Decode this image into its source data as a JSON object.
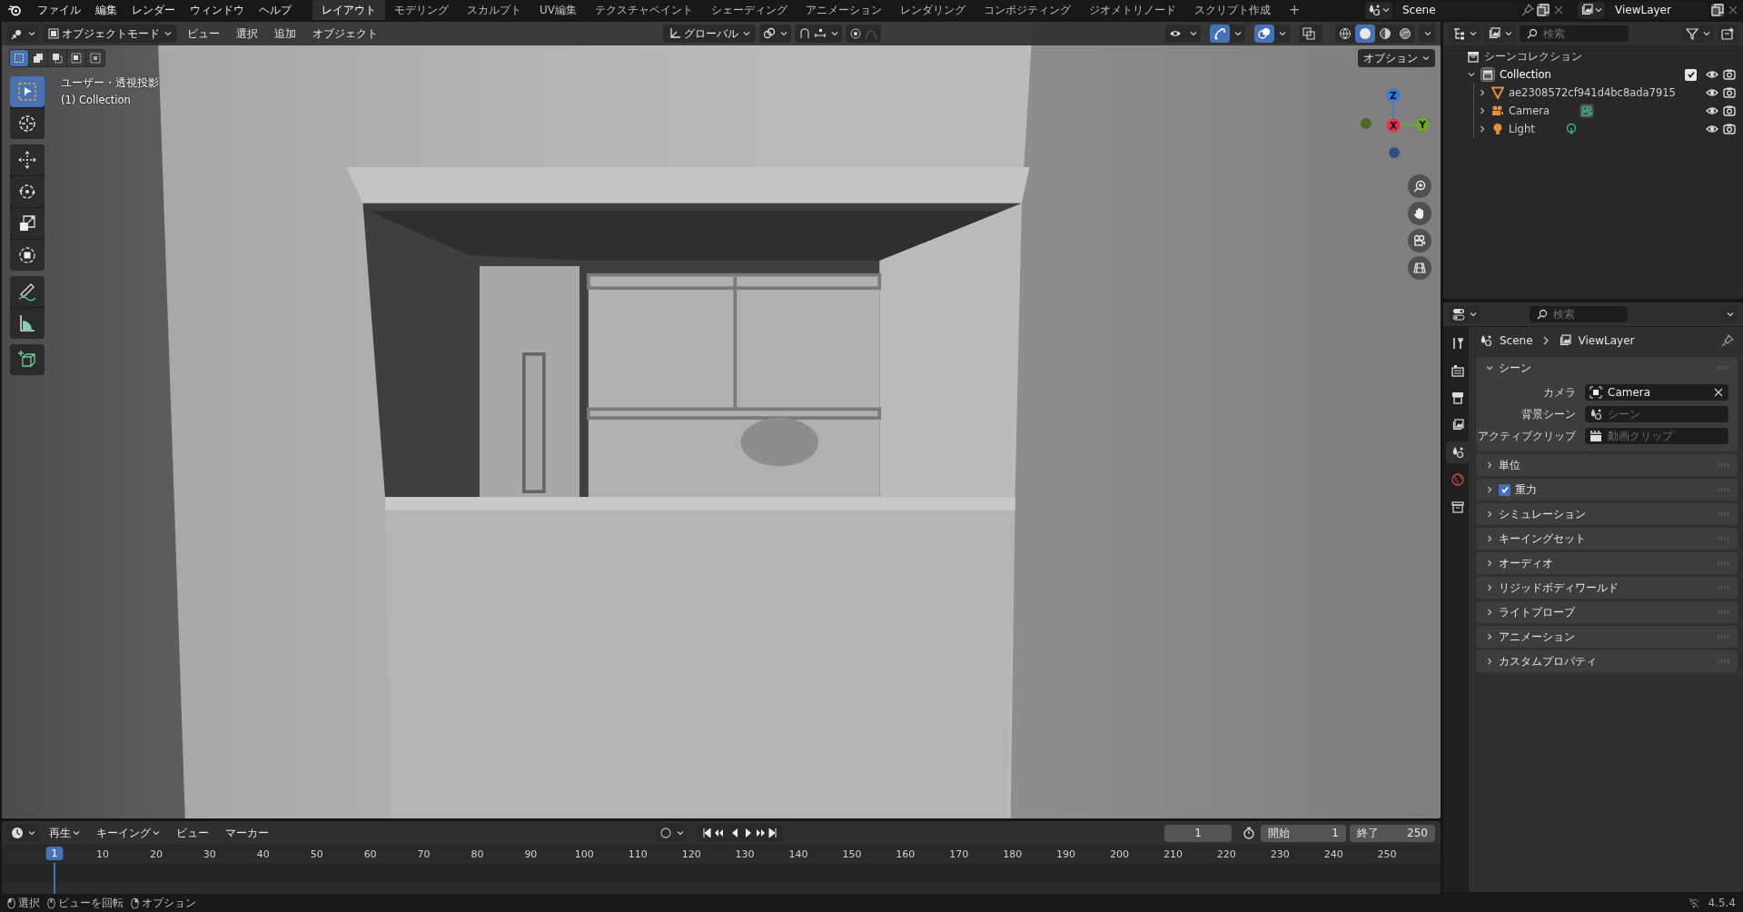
{
  "menu": [
    "ファイル",
    "編集",
    "レンダー",
    "ウィンドウ",
    "ヘルプ"
  ],
  "workspaces": [
    {
      "label": "レイアウト",
      "selected": true
    },
    {
      "label": "モデリング",
      "selected": false
    },
    {
      "label": "スカルプト",
      "selected": false
    },
    {
      "label": "UV編集",
      "selected": false
    },
    {
      "label": "テクスチャペイント",
      "selected": false
    },
    {
      "label": "シェーディング",
      "selected": false
    },
    {
      "label": "アニメーション",
      "selected": false
    },
    {
      "label": "レンダリング",
      "selected": false
    },
    {
      "label": "コンポジティング",
      "selected": false
    },
    {
      "label": "ジオメトリノード",
      "selected": false
    },
    {
      "label": "スクリプト作成",
      "selected": false
    }
  ],
  "add_workspace": "+",
  "scene": "Scene",
  "view_layer": "ViewLayer",
  "viewport": {
    "mode": "オブジェクトモード",
    "menus": [
      "ビュー",
      "選択",
      "追加",
      "オブジェクト"
    ],
    "orientation": "グローバル",
    "options": "オプション",
    "view_name": "ユーザー・透視投影",
    "collection_label": "(1) Collection",
    "select_modes": [
      {
        "kind": "new",
        "selected": true
      },
      {
        "kind": "extend",
        "selected": false
      },
      {
        "kind": "subtract",
        "selected": false
      },
      {
        "kind": "invert",
        "selected": false
      },
      {
        "kind": "intersect",
        "selected": false
      }
    ],
    "tool_groups": [
      [
        {
          "kind": "select",
          "selected": true
        },
        {
          "kind": "cursor",
          "selected": false
        }
      ],
      [
        {
          "kind": "move",
          "selected": false
        },
        {
          "kind": "rotate",
          "selected": false
        },
        {
          "kind": "scale",
          "selected": false
        },
        {
          "kind": "transform",
          "selected": false
        }
      ],
      [
        {
          "kind": "annotate",
          "selected": false
        },
        {
          "kind": "measure",
          "selected": false
        }
      ],
      [
        {
          "kind": "add_cube",
          "selected": false
        }
      ]
    ],
    "toggles": [
      {
        "kind": "visibility",
        "on": false
      },
      {
        "kind": "gizmo",
        "on": true
      },
      {
        "kind": "overlay",
        "on": true
      },
      {
        "kind": "xray",
        "on": false
      }
    ],
    "shading": [
      {
        "kind": "wireframe",
        "selected": false
      },
      {
        "kind": "solid",
        "selected": true
      },
      {
        "kind": "material",
        "selected": false
      },
      {
        "kind": "rendered",
        "selected": false
      }
    ],
    "axes": [
      "Z",
      "X",
      "Y"
    ]
  },
  "outliner": {
    "search_placeholder": "検索",
    "root": "シーンコレクション",
    "tree": [
      {
        "label": "Collection",
        "expanded": true,
        "checked": true,
        "children": [
          {
            "label": "ae2308572cf941d4bc8ada7915",
            "kind": "mesh",
            "expanded": false
          },
          {
            "label": "Camera",
            "kind": "camera",
            "expanded": false
          },
          {
            "label": "Light",
            "kind": "light",
            "expanded": false
          }
        ]
      }
    ]
  },
  "properties": {
    "search_placeholder": "検索",
    "breadcrumb": [
      "Scene",
      "ViewLayer"
    ],
    "tabs": [
      {
        "kind": "tool",
        "selected": false
      },
      {
        "kind": "render",
        "selected": false
      },
      {
        "kind": "output",
        "selected": false
      },
      {
        "kind": "view_layer",
        "selected": false
      },
      {
        "kind": "scene",
        "selected": true
      },
      {
        "kind": "world",
        "selected": false
      },
      {
        "kind": "collection",
        "selected": false
      }
    ],
    "panels": [
      {
        "title": "シーン",
        "expanded": true,
        "fields": [
          {
            "label": "カメラ",
            "kind": "camera",
            "value": "Camera"
          },
          {
            "label": "背景シーン",
            "kind": "scene",
            "placeholder": "シーン"
          },
          {
            "label": "アクティブクリップ",
            "kind": "clip",
            "placeholder": "動画クリップ"
          }
        ]
      },
      {
        "title": "単位",
        "expanded": false
      },
      {
        "title": "重力",
        "expanded": false,
        "checked": true
      },
      {
        "title": "シミュレーション",
        "expanded": false
      },
      {
        "title": "キーイングセット",
        "expanded": false
      },
      {
        "title": "オーディオ",
        "expanded": false
      },
      {
        "title": "リジッドボディワールド",
        "expanded": false
      },
      {
        "title": "ライトプローブ",
        "expanded": false
      },
      {
        "title": "アニメーション",
        "expanded": false
      },
      {
        "title": "カスタムプロパティ",
        "expanded": false
      }
    ]
  },
  "timeline": {
    "menus": [
      "再生",
      "キーイング",
      "ビュー",
      "マーカー"
    ],
    "current_frame": "1",
    "start_label": "開始",
    "start": "1",
    "end_label": "終了",
    "end": "250",
    "ruler": [
      "1",
      "10",
      "20",
      "30",
      "40",
      "50",
      "60",
      "70",
      "80",
      "90",
      "100",
      "110",
      "120",
      "130",
      "140",
      "150",
      "160",
      "170",
      "180",
      "190",
      "200",
      "210",
      "220",
      "230",
      "240",
      "250"
    ]
  },
  "status_bar": {
    "hints": [
      "選択",
      "ビューを回転",
      "オプション"
    ],
    "version": "4.5.4"
  }
}
